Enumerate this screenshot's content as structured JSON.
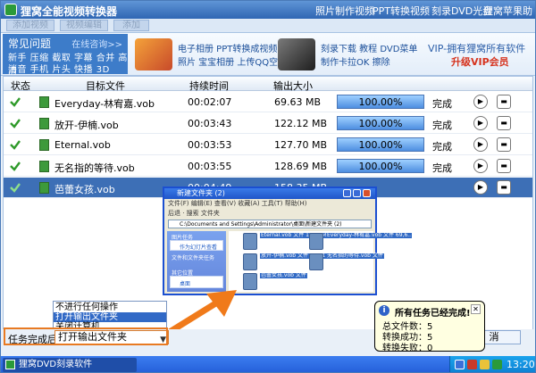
{
  "window": {
    "title": "狸窝全能视频转换器",
    "top_links": [
      "照片制作视频",
      "PPT转换视频",
      "刻录DVD光盘",
      "狸窝苹果助手"
    ]
  },
  "toolbar": {
    "buttons": [
      "添加视频",
      "视频编辑",
      "添加"
    ]
  },
  "faq": {
    "title": "常见问题",
    "more": "在线咨询>>",
    "lines": [
      "新手 压缩 截取 字幕 合并 高清",
      "消音 手机 片头 快播 3D"
    ]
  },
  "promos": {
    "promo1": {
      "line1": "电子相册 PPT转换成视频",
      "line2": "照片 宝宝相册 上传QQ空间"
    },
    "promo2": {
      "line1": "刻录下载 教程 DVD菜单",
      "line2": "制作卡拉OK 擦除"
    },
    "vip_line1": "VIP-拥有狸窝所有软件",
    "vip_line2": "升级VIP会员"
  },
  "table": {
    "headers": {
      "status": "状态",
      "target": "目标文件",
      "duration": "持续时间",
      "output_size": "输出大小"
    },
    "rows": [
      {
        "name": "Everyday-林宥嘉.vob",
        "duration": "00:02:07",
        "size": "69.63 MB",
        "progress": "100.00%",
        "state": "完成"
      },
      {
        "name": "放开-伊楠.vob",
        "duration": "00:03:43",
        "size": "122.12 MB",
        "progress": "100.00%",
        "state": "完成"
      },
      {
        "name": "Eternal.vob",
        "duration": "00:03:53",
        "size": "127.70 MB",
        "progress": "100.00%",
        "state": "完成"
      },
      {
        "name": "无名指的等待.vob",
        "duration": "00:03:55",
        "size": "128.69 MB",
        "progress": "100.00%",
        "state": "完成"
      },
      {
        "name": "芭蕾女孩.vob",
        "duration": "00:04:49",
        "size": "158.35 MB",
        "progress": "",
        "state": ""
      }
    ]
  },
  "explorer": {
    "title": "新建文件夹 (2)",
    "menu": "文件(F) 编辑(E) 查看(V) 收藏(A) 工具(T) 帮助(H)",
    "tools": "后退  ·  搜索  文件夹  ",
    "address": "C:\\Documents and Settings\\Administrator\\桌面\\新建文件夹 (2)",
    "side_head1": "图片任务",
    "side_item1": "作为幻灯片查看",
    "side_head2": "文件和文件夹任务",
    "side_head3": "其它位置",
    "side_item3": "桌面",
    "files": [
      "Eternal.vob 文件 127,766 KB",
      "Everyday-林宥嘉.vob 文件 69,6..",
      "放开-伊楠.vob 文件 122,170 KB",
      "无名指的等待.vob 文件",
      "芭蕾女孩.vob 文件"
    ]
  },
  "on_complete": {
    "label": "任务完成后:",
    "value": "打开输出文件夹",
    "options": [
      "不进行任何操作",
      "打开输出文件夹",
      "关闭计算机"
    ],
    "cancel_label": "消"
  },
  "balloon": {
    "title": "所有任务已经完成!",
    "total": "总文件数：5",
    "success": "转换成功：5",
    "failed": "转换失败：0"
  },
  "taskbar": {
    "app_label": "狸窝DVD刻录软件",
    "time": "13:20"
  },
  "colors": {
    "progress": "#4d8ee0",
    "selected_row": "#3d6fb6",
    "highlight_orange": "#e87a22"
  }
}
